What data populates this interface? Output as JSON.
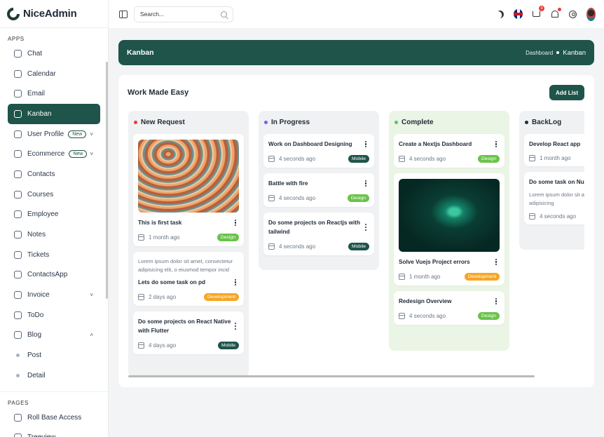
{
  "brand": {
    "name": "NiceAdmin"
  },
  "sidebar": {
    "sections": [
      {
        "title": "APPS",
        "items": [
          {
            "label": "Chat"
          },
          {
            "label": "Calendar"
          },
          {
            "label": "Email"
          },
          {
            "label": "Kanban",
            "active": true
          },
          {
            "label": "User Profile",
            "badge": "New",
            "chevron": "˅"
          },
          {
            "label": "Ecommerce",
            "badge": "New",
            "chevron": "˅"
          },
          {
            "label": "Contacts"
          },
          {
            "label": "Courses"
          },
          {
            "label": "Employee"
          },
          {
            "label": "Notes"
          },
          {
            "label": "Tickets"
          },
          {
            "label": "ContactsApp"
          },
          {
            "label": "Invoice",
            "chevron": "˅"
          },
          {
            "label": "ToDo"
          },
          {
            "label": "Blog",
            "chevron": "˄"
          },
          {
            "label": "Post"
          },
          {
            "label": "Detail"
          }
        ]
      },
      {
        "title": "PAGES",
        "items": [
          {
            "label": "Roll Base Access"
          },
          {
            "label": "Treeview"
          }
        ]
      }
    ]
  },
  "topbar": {
    "search": {
      "placeholder": "Search..."
    },
    "cart_count": "0"
  },
  "breadcrumb": {
    "title": "Kanban",
    "link": "Dashboard",
    "current": "Kanban"
  },
  "board": {
    "title": "Work Made Easy",
    "add_button": "Add List",
    "lanes": [
      {
        "title": "New Request",
        "dot_color": "#e93c3c",
        "bg": "#f0f1f2",
        "cards": [
          {
            "image": "waves",
            "title": "This is first task",
            "time": "1 month ago",
            "tag": "Design"
          },
          {
            "desc": "Lorem ipsum dolor sit amet, consectetur adipisicing elit, o eiusmod tempor incid",
            "title": "Lets do some task on pd",
            "time": "2 days ago",
            "tag": "Development"
          },
          {
            "title": "Do some projects on React Native with Flutter",
            "time": "4 days ago",
            "tag": "Mobile"
          }
        ]
      },
      {
        "title": "In Progress",
        "dot_color": "#7a5cf0",
        "bg": "#f0f1f2",
        "cards": [
          {
            "title": "Work on Dashboard Designing",
            "time": "4 seconds ago",
            "tag": "Mobile"
          },
          {
            "title": "Battle with fire",
            "time": "4 seconds ago",
            "tag": "Design"
          },
          {
            "title": "Do some projects on Reactjs with tailwind",
            "time": "4 seconds ago",
            "tag": "Mobile"
          }
        ]
      },
      {
        "title": "Complete",
        "dot_color": "#5fc35f",
        "bg": "#eaf5e6",
        "cards": [
          {
            "title": "Create a Nextjs Dashboard",
            "time": "4 seconds ago",
            "tag": "Design"
          },
          {
            "image": "dark",
            "title": "Solve Vuejs Project errors",
            "time": "1 month ago",
            "tag": "Development"
          },
          {
            "title": "Redesign Overview",
            "time": "4 seconds ago",
            "tag": "Design"
          }
        ]
      },
      {
        "title": "BackLog",
        "dot_color": "#1f2a37",
        "bg": "#f0f1f2",
        "cards": [
          {
            "title": "Develop React app",
            "time": "1 month ago"
          },
          {
            "title": "Do some task on Nuxt",
            "desc": "Lorem ipsum dolor sit amet, consectetur adipisicing",
            "time": "4 seconds ago"
          }
        ]
      }
    ]
  },
  "tag_colors": {
    "Design": "#69c34a",
    "Development": "#f6a623",
    "Mobile": "#1e5449"
  }
}
